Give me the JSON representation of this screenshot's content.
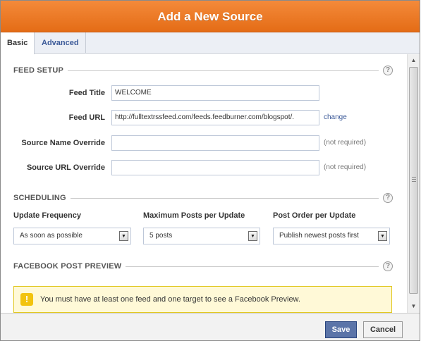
{
  "dialog": {
    "title": "Add a New Source"
  },
  "tabs": [
    {
      "label": "Basic",
      "active": true
    },
    {
      "label": "Advanced",
      "active": false
    }
  ],
  "feed_setup": {
    "heading": "FEED SETUP",
    "help": "?",
    "feed_title": {
      "label": "Feed Title",
      "value": "WELCOME"
    },
    "feed_url": {
      "label": "Feed URL",
      "value": "http://fulltextrssfeed.com/feeds.feedburner.com/blogspot/.",
      "link": "change"
    },
    "source_name_override": {
      "label": "Source Name Override",
      "value": "",
      "hint": "(not required)"
    },
    "source_url_override": {
      "label": "Source URL Override",
      "value": "",
      "hint": "(not required)"
    }
  },
  "scheduling": {
    "heading": "SCHEDULING",
    "help": "?",
    "update_frequency": {
      "label": "Update Frequency",
      "selected": "As soon as possible"
    },
    "max_posts": {
      "label": "Maximum Posts per Update",
      "selected": "5 posts"
    },
    "post_order": {
      "label": "Post Order per Update",
      "selected": "Publish newest posts first"
    }
  },
  "preview": {
    "heading": "FACEBOOK POST PREVIEW",
    "help": "?",
    "warning_icon": "!",
    "warning_text": "You must have at least one feed and one target to see a Facebook Preview."
  },
  "footer": {
    "save_label": "Save",
    "cancel_label": "Cancel"
  },
  "icons": {
    "help": "help-icon",
    "warning": "warning-icon",
    "dropdown": "chevron-down-icon"
  },
  "colors": {
    "title_bar": "#ec7a24",
    "link": "#3b5998",
    "save_button": "#5b74a8",
    "warning_bg": "#fff9d7"
  }
}
